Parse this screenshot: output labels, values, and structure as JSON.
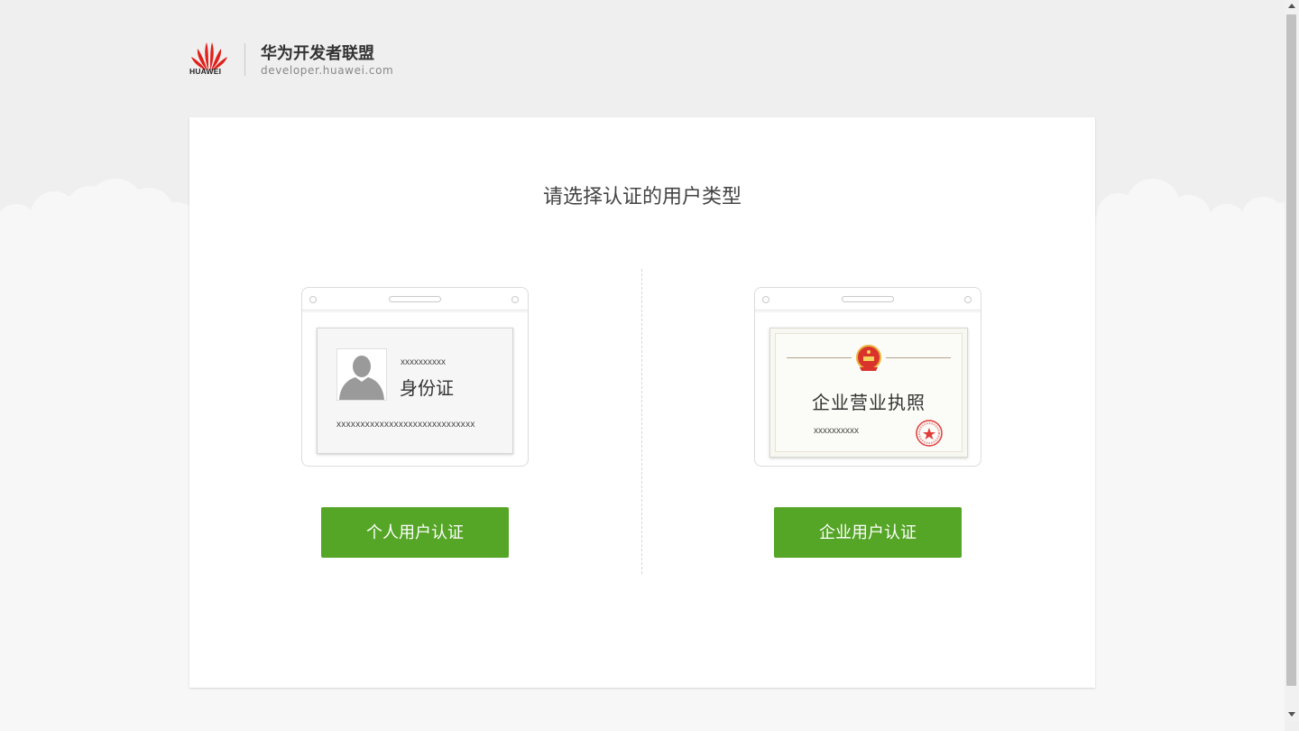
{
  "header": {
    "logo_text": "HUAWEI",
    "brand_title": "华为开发者联盟",
    "brand_url": "developer.huawei.com"
  },
  "main": {
    "title": "请选择认证的用户类型",
    "personal": {
      "id_placeholder": "xxxxxxxxxx",
      "id_title": "身份证",
      "id_number": "xxxxxxxxxxxxxxxxxxxxxxxxxxxxx",
      "button_label": "个人用户认证"
    },
    "enterprise": {
      "license_title": "企业营业执照",
      "license_placeholder": "xxxxxxxxxx",
      "button_label": "企业用户认证"
    }
  },
  "colors": {
    "accent": "#55a527",
    "brand_red": "#e0201b",
    "background": "#efefef"
  },
  "icons": [
    "huawei-logo",
    "person-silhouette-icon",
    "national-emblem-icon",
    "red-seal-icon",
    "scroll-up-arrow-icon",
    "scroll-down-arrow-icon"
  ]
}
